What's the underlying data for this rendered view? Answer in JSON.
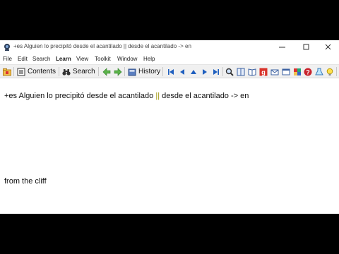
{
  "window": {
    "title": "+es Alguien lo precipitó desde el acantilado || desde el acantilado -> en"
  },
  "menubar": {
    "items": [
      {
        "label": "File"
      },
      {
        "label": "Edit"
      },
      {
        "label": "Search"
      },
      {
        "label": "Learn"
      },
      {
        "label": "View"
      },
      {
        "label": "Toolkit"
      },
      {
        "label": "Window"
      },
      {
        "label": "Help"
      }
    ]
  },
  "toolbar": {
    "contents_label": "Contents",
    "search_label": "Search",
    "history_label": "History"
  },
  "content": {
    "source_left": "+es Alguien lo precipitó desde el acantilado ",
    "source_sep": "||",
    "source_right": " desde el acantilado -> en",
    "translation": "from the cliff"
  },
  "colors": {
    "separator_text": "#9a9000",
    "accent_blue": "#1f5fbf"
  }
}
